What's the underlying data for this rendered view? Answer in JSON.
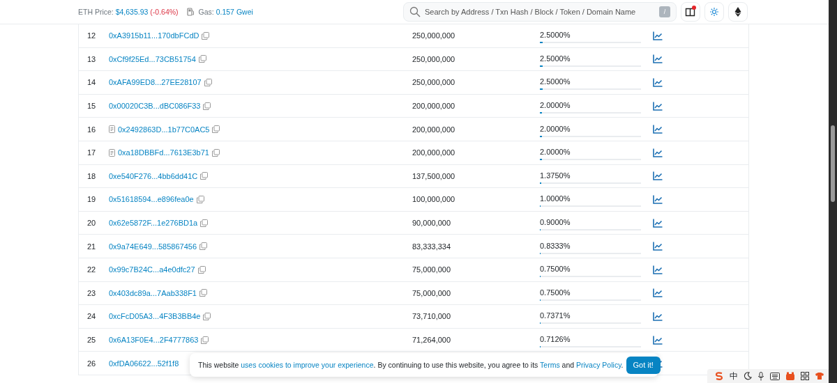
{
  "header": {
    "price_label": "ETH Price:",
    "price": "$4,635.93",
    "change": "(-0.64%)",
    "gas_label": "Gas:",
    "gas": "0.157 Gwei",
    "search": {
      "placeholder": "Search by Address / Txn Hash / Block / Token / Domain Name",
      "shortcut": "/"
    },
    "notification": true
  },
  "rows": [
    {
      "rank": "12",
      "address": "0xA3915b11...170dbFCdD",
      "contract": false,
      "quantity": "250,000,000",
      "percentage": "2.5000%",
      "level": 0.025
    },
    {
      "rank": "13",
      "address": "0xCf9f25Ed...73CB51754",
      "contract": false,
      "quantity": "250,000,000",
      "percentage": "2.5000%",
      "level": 0.025
    },
    {
      "rank": "14",
      "address": "0xAFA99ED8...27EE28107",
      "contract": false,
      "quantity": "250,000,000",
      "percentage": "2.5000%",
      "level": 0.025
    },
    {
      "rank": "15",
      "address": "0x00020C3B...dBC086F33",
      "contract": false,
      "quantity": "200,000,000",
      "percentage": "2.0000%",
      "level": 0.02
    },
    {
      "rank": "16",
      "address": "0x2492863D...1b77C0AC5",
      "contract": true,
      "quantity": "200,000,000",
      "percentage": "2.0000%",
      "level": 0.02
    },
    {
      "rank": "17",
      "address": "0xa18DBBFd...7613E3b71",
      "contract": true,
      "quantity": "200,000,000",
      "percentage": "2.0000%",
      "level": 0.02
    },
    {
      "rank": "18",
      "address": "0xe540F276...4bb6dd41C",
      "contract": false,
      "quantity": "137,500,000",
      "percentage": "1.3750%",
      "level": 0.01375
    },
    {
      "rank": "19",
      "address": "0x51618594...e896fea0e",
      "contract": false,
      "quantity": "100,000,000",
      "percentage": "1.0000%",
      "level": 0.01
    },
    {
      "rank": "20",
      "address": "0x62e5872F...1e276BD1a",
      "contract": false,
      "quantity": "90,000,000",
      "percentage": "0.9000%",
      "level": 0.009
    },
    {
      "rank": "21",
      "address": "0x9a74E649...585867456",
      "contract": false,
      "quantity": "83,333,334",
      "percentage": "0.8333%",
      "level": 0.008333
    },
    {
      "rank": "22",
      "address": "0x99c7B24C...a4e0dfc27",
      "contract": false,
      "quantity": "75,000,000",
      "percentage": "0.7500%",
      "level": 0.0075
    },
    {
      "rank": "23",
      "address": "0x403dc89a...7Aab338F1",
      "contract": false,
      "quantity": "75,000,000",
      "percentage": "0.7500%",
      "level": 0.0075
    },
    {
      "rank": "24",
      "address": "0xcFcD05A3...4F3B3BB4e",
      "contract": false,
      "quantity": "73,710,000",
      "percentage": "0.7371%",
      "level": 0.007371
    },
    {
      "rank": "25",
      "address": "0x6A13F0E4...2F4777863",
      "contract": false,
      "quantity": "71,264,000",
      "percentage": "0.7126%",
      "level": 0.007126
    },
    {
      "rank": "26",
      "address": "0xfDA06622...52f1f8",
      "contract": false,
      "covered": true
    }
  ],
  "cookie_banner": {
    "text_before": "This website",
    "link": "uses cookies to improve your experience",
    "text_middle": ". By continuing to use this website, you agree to its",
    "terms": "Terms",
    "text_and": "and",
    "privacy": "Privacy Policy",
    "text_end": ".",
    "button": "Got it!"
  },
  "tray": {
    "ime": "中"
  }
}
